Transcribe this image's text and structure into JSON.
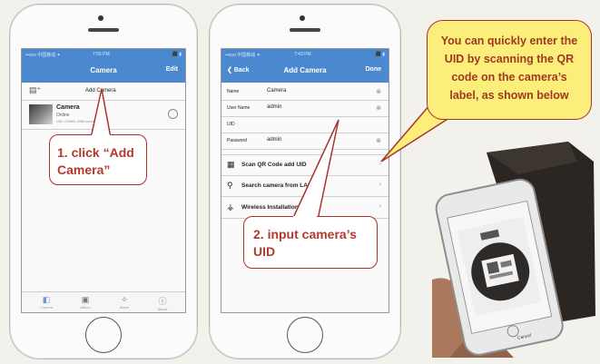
{
  "phone1": {
    "status_carrier": "••ooo 中国移动 ✦",
    "status_time": "7:55 PM",
    "status_battery": "⬛ ▮",
    "nav_title": "Camera",
    "nav_right": "Edit",
    "add_camera_label": "Add Camera",
    "camera_name": "Camera",
    "camera_status": "Online",
    "camera_uid": "UID: CWKE-0000-xxxxx",
    "tabs": [
      "Camera",
      "Album",
      "Alarm",
      "About"
    ]
  },
  "phone2": {
    "status_carrier": "••ooo 中国移动 ✦",
    "status_time": "7:43 PM",
    "status_battery": "⬛ ▮",
    "nav_back": "Back",
    "nav_title": "Add Camera",
    "nav_right": "Done",
    "fields": [
      {
        "label": "Name",
        "value": "Camera"
      },
      {
        "label": "User Name",
        "value": "admin"
      },
      {
        "label": "UID",
        "value": ""
      },
      {
        "label": "Password",
        "value": "admin"
      }
    ],
    "options": [
      {
        "label": "Scan QR Code add UID",
        "icon": "qr-code-icon"
      },
      {
        "label": "Search camera from LAN",
        "icon": "search-icon"
      },
      {
        "label": "Wireless Installation",
        "icon": "wifi-icon"
      }
    ]
  },
  "callouts": {
    "step1": "1. click “Add Camera”",
    "step2": "2. input camera’s UID",
    "qr_note": "You can quickly enter the UID by scanning the QR code on the camera’s label, as shown below"
  },
  "photo": {
    "cancel_label": "Cancel"
  }
}
